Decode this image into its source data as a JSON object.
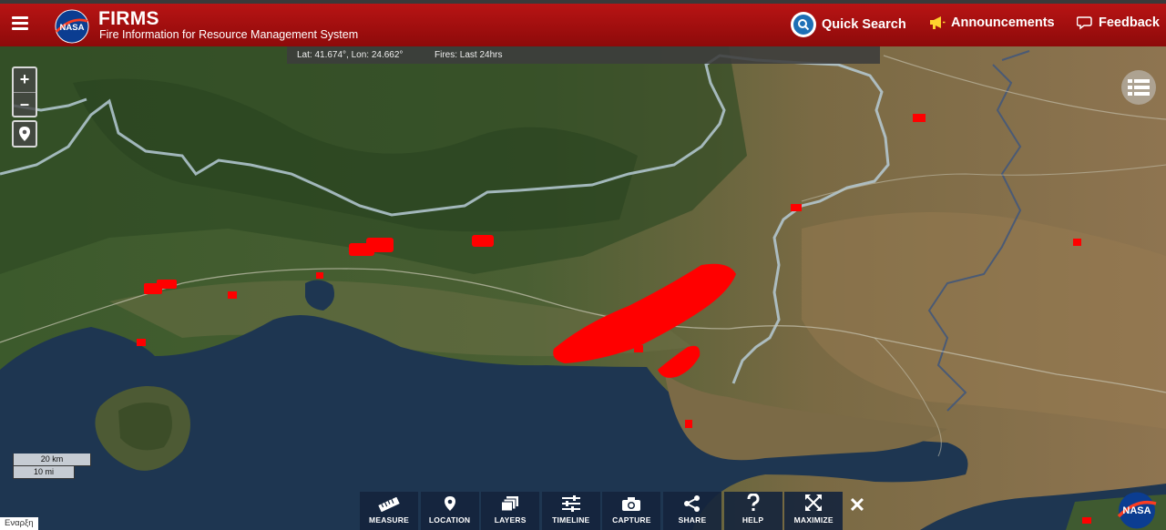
{
  "header": {
    "title": "FIRMS",
    "subtitle": "Fire Information for Resource Management System",
    "logo_text": "NASA",
    "quick_search_label": "Quick Search",
    "announcements_label": "Announcements",
    "feedback_label": "Feedback"
  },
  "infobar": {
    "coords": "Lat: 41.674°, Lon: 24.662°",
    "fires": "Fires: Last 24hrs"
  },
  "map_controls": {
    "zoom_in": "+",
    "zoom_out": "–"
  },
  "scale": {
    "km": "20 km",
    "mi": "10 mi"
  },
  "attribution": "Εναρξη",
  "toolbar": {
    "items": [
      {
        "label": "MEASURE",
        "icon": "ruler-icon"
      },
      {
        "label": "LOCATION",
        "icon": "map-pin-icon"
      },
      {
        "label": "LAYERS",
        "icon": "layers-icon"
      },
      {
        "label": "TIMELINE",
        "icon": "sliders-icon"
      },
      {
        "label": "CAPTURE",
        "icon": "camera-icon"
      },
      {
        "label": "SHARE",
        "icon": "share-icon"
      },
      {
        "label": "HELP",
        "icon": "question-icon"
      },
      {
        "label": "MAXIMIZE",
        "icon": "maximize-icon"
      }
    ],
    "close": "✕"
  },
  "colors": {
    "header_red": "#b81414",
    "fire_red": "#ff0000",
    "sea": "#1d3550",
    "border_line": "#b6cbd6"
  }
}
